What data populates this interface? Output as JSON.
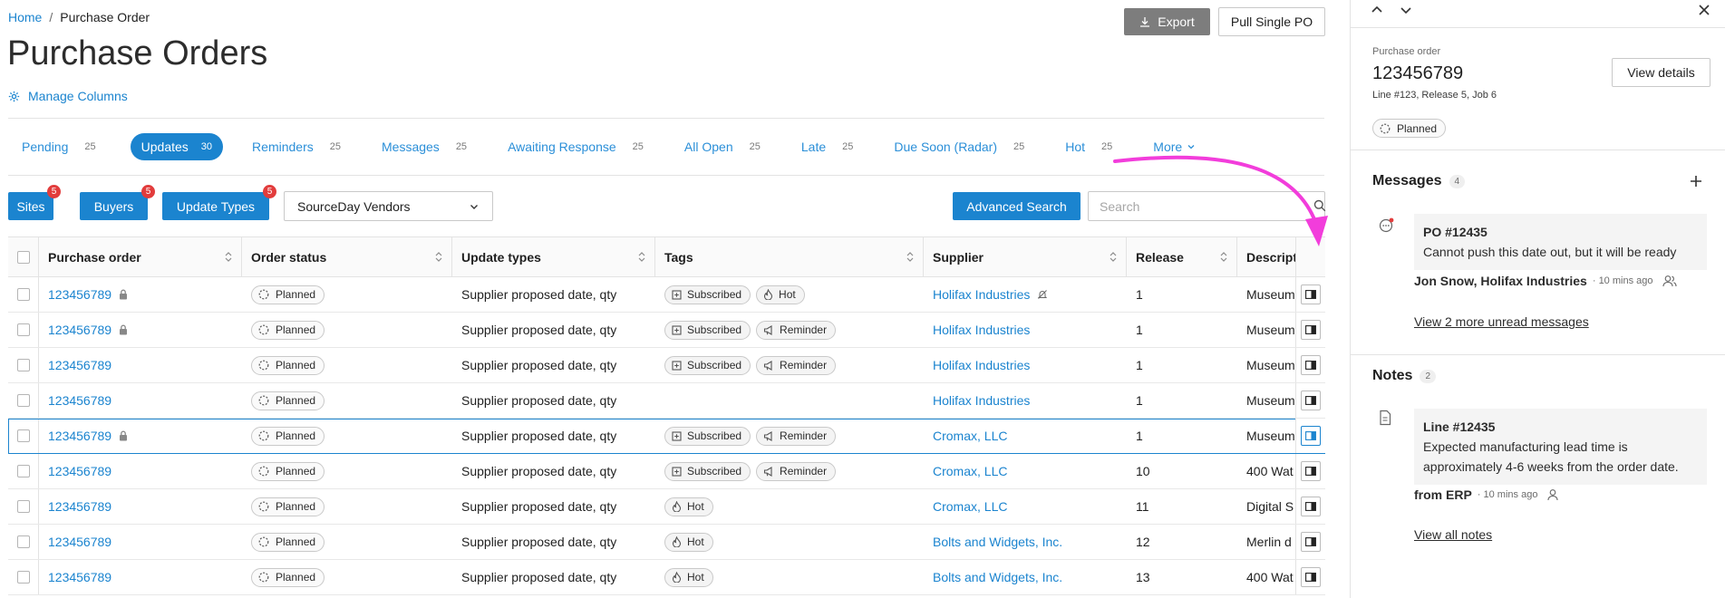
{
  "breadcrumb": {
    "home": "Home",
    "separator": "/",
    "current": "Purchase Order"
  },
  "page_title": "Purchase Orders",
  "manage_columns": "Manage Columns",
  "header_actions": {
    "export": "Export",
    "pull_single": "Pull Single PO"
  },
  "tabs": [
    {
      "label": "Pending",
      "count": "25"
    },
    {
      "label": "Updates",
      "count": "30",
      "active": true
    },
    {
      "label": "Reminders",
      "count": "25"
    },
    {
      "label": "Messages",
      "count": "25"
    },
    {
      "label": "Awaiting Response",
      "count": "25"
    },
    {
      "label": "All Open",
      "count": "25"
    },
    {
      "label": "Late",
      "count": "25"
    },
    {
      "label": "Due Soon (Radar)",
      "count": "25"
    },
    {
      "label": "Hot",
      "count": "25"
    }
  ],
  "more_tab": "More",
  "filters": {
    "sites": {
      "label": "Sites",
      "badge": "5"
    },
    "buyers": {
      "label": "Buyers",
      "badge": "5"
    },
    "update_types": {
      "label": "Update Types",
      "badge": "5"
    },
    "vendor_select": "SourceDay Vendors",
    "advanced_search": "Advanced Search",
    "search_placeholder": "Search"
  },
  "columns": {
    "po": "Purchase order",
    "status": "Order status",
    "updates": "Update types",
    "tags": "Tags",
    "supplier": "Supplier",
    "release": "Release",
    "description": "Description"
  },
  "rows": [
    {
      "po": "123456789",
      "status": "Planned",
      "updates": "Supplier proposed date, qty",
      "tag1": "Subscribed",
      "tag2": "Hot",
      "supplier": "Holifax Industries",
      "release": "1",
      "desc": "Museum"
    },
    {
      "po": "123456789",
      "status": "Planned",
      "updates": "Supplier proposed date, qty",
      "tag1": "Subscribed",
      "tag2": "Reminder",
      "supplier": "Holifax Industries",
      "release": "1",
      "desc": "Museum"
    },
    {
      "po": "123456789",
      "status": "Planned",
      "updates": "Supplier proposed date, qty",
      "tag1": "Subscribed",
      "tag2": "Reminder",
      "supplier": "Holifax Industries",
      "release": "1",
      "desc": "Museum"
    },
    {
      "po": "123456789",
      "status": "Planned",
      "updates": "Supplier proposed date, qty",
      "tag1": "",
      "tag2": "",
      "supplier": "Holifax Industries",
      "release": "1",
      "desc": "Museum"
    },
    {
      "po": "123456789",
      "status": "Planned",
      "updates": "Supplier proposed date, qty",
      "tag1": "Subscribed",
      "tag2": "Reminder",
      "supplier": "Cromax, LLC",
      "release": "1",
      "desc": "Museum"
    },
    {
      "po": "123456789",
      "status": "Planned",
      "updates": "Supplier proposed date, qty",
      "tag1": "Subscribed",
      "tag2": "Reminder",
      "supplier": "Cromax, LLC",
      "release": "10",
      "desc": "400 Wat"
    },
    {
      "po": "123456789",
      "status": "Planned",
      "updates": "Supplier proposed date, qty",
      "tag1": "Hot",
      "tag2": "",
      "supplier": "Cromax, LLC",
      "release": "11",
      "desc": "Digital S"
    },
    {
      "po": "123456789",
      "status": "Planned",
      "updates": "Supplier proposed date, qty",
      "tag1": "Hot",
      "tag2": "",
      "supplier": "Bolts and Widgets, Inc.",
      "release": "12",
      "desc": "Merlin d"
    },
    {
      "po": "123456789",
      "status": "Planned",
      "updates": "Supplier proposed date, qty",
      "tag1": "Hot",
      "tag2": "",
      "supplier": "Bolts and Widgets, Inc.",
      "release": "13",
      "desc": "400 Wat"
    }
  ],
  "panel": {
    "label": "Purchase order",
    "po": "123456789",
    "sub": "Line #123, Release 5, Job 6",
    "view_details": "View details",
    "status": "Planned",
    "messages": {
      "title": "Messages",
      "count": "4",
      "card_title": "PO #12435",
      "card_body": "Cannot push this date out, but it will be ready",
      "author": "Jon Snow, Holifax Industries",
      "ago": "· 10 mins ago",
      "more_link": "View 2 more unread messages"
    },
    "notes": {
      "title": "Notes",
      "count": "2",
      "card_title": "Line #12435",
      "card_body": "Expected manufacturing lead time is approximately 4-6 weeks from the order date.",
      "author": "from ERP",
      "ago": "· 10 mins ago",
      "all_link": "View all notes"
    }
  },
  "colors": {
    "primary": "#1b84cf",
    "badge": "#e23c3c",
    "arrow": "#f23ddb",
    "export": "#7d7d7d"
  }
}
